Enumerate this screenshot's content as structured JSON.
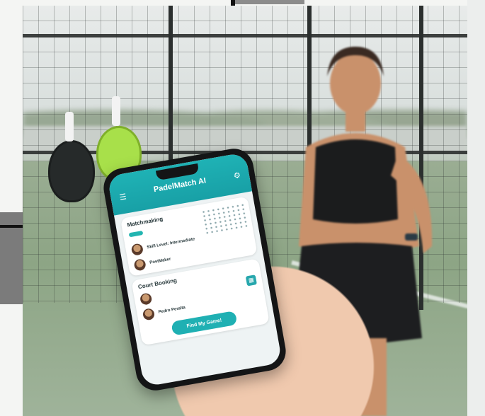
{
  "app": {
    "title": "PadelMatch AI",
    "menu_icon": "hamburger-menu-icon",
    "settings_icon": "gear-icon"
  },
  "matchmaking": {
    "title": "Matchmaking",
    "pill": "",
    "players": [
      {
        "name": "Skill Level: Intermediate",
        "sub": ""
      },
      {
        "name": "PostMaker",
        "sub": ""
      }
    ]
  },
  "court_booking": {
    "title": "Court Booking",
    "players": [
      {
        "name": "",
        "sub": ""
      },
      {
        "name": "Pedro Peralta",
        "sub": ""
      }
    ]
  },
  "cta_label": "Find My Game!",
  "colors": {
    "teal": "#1fb0b3",
    "court_green": "#8da585",
    "fence": "#2b2f2e"
  }
}
